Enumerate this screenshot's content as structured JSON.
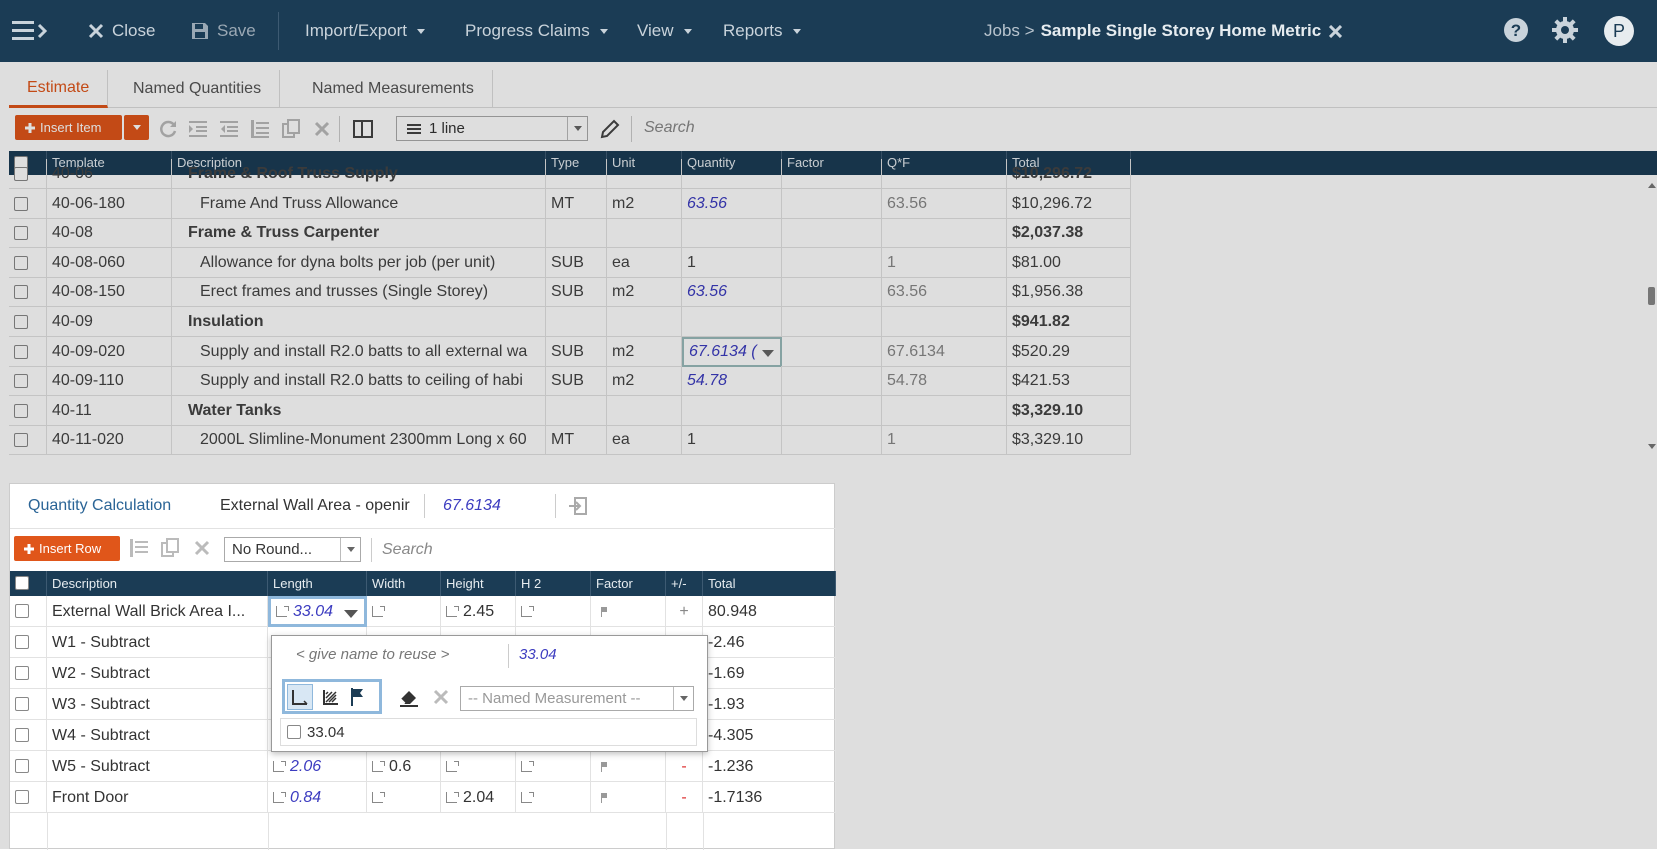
{
  "topbar": {
    "close_label": "Close",
    "save_label": "Save",
    "menus": [
      "Import/Export",
      "Progress Claims",
      "View",
      "Reports"
    ],
    "breadcrumb_prefix": "Jobs >",
    "job_title": "Sample Single Storey Home Metric",
    "avatar_letter": "P"
  },
  "tabs": [
    "Estimate",
    "Named Quantities",
    "Named Measurements"
  ],
  "toolbar": {
    "insert_item_label": "Insert Item",
    "lines_select": "1 line",
    "search_placeholder": "Search"
  },
  "grid": {
    "columns": [
      "Template",
      "Description",
      "Type",
      "Unit",
      "Quantity",
      "Factor",
      "Q*F",
      "Total"
    ],
    "rows": [
      {
        "template": "40-06",
        "description": "Frame & Roof Truss Supply",
        "type": "",
        "unit": "",
        "quantity": "",
        "qf": "",
        "total": "$10,296.72",
        "group": true
      },
      {
        "template": "40-06-180",
        "description": "Frame And Truss Allowance",
        "type": "MT",
        "unit": "m2",
        "quantity": "63.56",
        "qf": "63.56",
        "total": "$10,296.72",
        "group": false,
        "qty_link": true
      },
      {
        "template": "40-08",
        "description": "Frame & Truss Carpenter",
        "type": "",
        "unit": "",
        "quantity": "",
        "qf": "",
        "total": "$2,037.38",
        "group": true
      },
      {
        "template": "40-08-060",
        "description": "Allowance for dyna bolts per job (per unit)",
        "type": "SUB",
        "unit": "ea",
        "quantity": "1",
        "qf": "1",
        "total": "$81.00",
        "group": false,
        "qty_link": false
      },
      {
        "template": "40-08-150",
        "description": "Erect frames and trusses (Single Storey)",
        "type": "SUB",
        "unit": "m2",
        "quantity": "63.56",
        "qf": "63.56",
        "total": "$1,956.38",
        "group": false,
        "qty_link": true
      },
      {
        "template": "40-09",
        "description": "Insulation",
        "type": "",
        "unit": "",
        "quantity": "",
        "qf": "",
        "total": "$941.82",
        "group": true
      },
      {
        "template": "40-09-020",
        "description": "Supply and install R2.0 batts to all external wa",
        "type": "SUB",
        "unit": "m2",
        "quantity": "67.6134 (",
        "qf": "67.6134",
        "total": "$520.29",
        "group": false,
        "qty_link": true,
        "editing": true
      },
      {
        "template": "40-09-110",
        "description": "Supply and install R2.0 batts to ceiling of habi",
        "type": "SUB",
        "unit": "m2",
        "quantity": "54.78",
        "qf": "54.78",
        "total": "$421.53",
        "group": false,
        "qty_link": true
      },
      {
        "template": "40-11",
        "description": "Water Tanks",
        "type": "",
        "unit": "",
        "quantity": "",
        "qf": "",
        "total": "$3,329.10",
        "group": true
      },
      {
        "template": "40-11-020",
        "description": "2000L Slimline-Monument 2300mm Long x 60",
        "type": "MT",
        "unit": "ea",
        "quantity": "1",
        "qf": "1",
        "total": "$3,329.10",
        "group": false,
        "qty_link": false
      }
    ]
  },
  "qcalc": {
    "title": "Quantity Calculation",
    "name": "External Wall Area - openir",
    "value": "67.6134",
    "insert_row_label": "Insert Row",
    "rounding": "No Round...",
    "search_placeholder": "Search",
    "columns": [
      "Description",
      "Length",
      "Width",
      "Height",
      "H 2",
      "Factor",
      "+/-",
      "Total"
    ],
    "rows": [
      {
        "description": "External Wall Brick Area I...",
        "length": "33.04",
        "width": "",
        "height": "2.45",
        "sign": "+",
        "total": "80.948",
        "editing": true
      },
      {
        "description": "W1 - Subtract",
        "length": "",
        "width": "",
        "height": "",
        "sign": "",
        "total": "-2.46"
      },
      {
        "description": "W2 - Subtract",
        "length": "",
        "width": "",
        "height": "",
        "sign": "",
        "total": "-1.69"
      },
      {
        "description": "W3 - Subtract",
        "length": "",
        "width": "",
        "height": "",
        "sign": "",
        "total": "-1.93"
      },
      {
        "description": "W4 - Subtract",
        "length": "",
        "width": "",
        "height": "",
        "sign": "",
        "total": "-4.305"
      },
      {
        "description": "W5 - Subtract",
        "length": "2.06",
        "width": "0.6",
        "height": "",
        "sign": "-",
        "total": "-1.236"
      },
      {
        "description": "Front Door",
        "length": "0.84",
        "width": "",
        "height": "2.04",
        "sign": "-",
        "total": "-1.7136"
      }
    ]
  },
  "popup": {
    "name_placeholder": "< give name to reuse >",
    "value": "33.04",
    "named_measurement_select": "-- Named Measurement --",
    "checkbox_label": "33.04"
  },
  "colors": {
    "nav": "#1b3c55",
    "accent": "#e0561a",
    "link_value": "#3c3cc0"
  }
}
